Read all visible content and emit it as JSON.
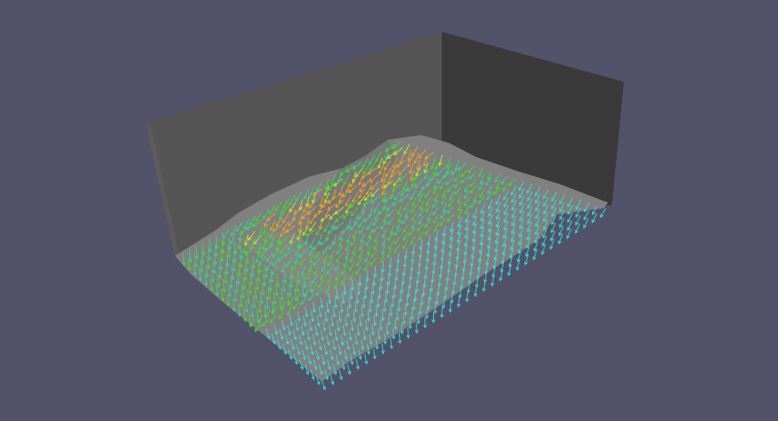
{
  "scene": {
    "background": "#52526b",
    "wall_back_left": "#555555",
    "wall_back_right": "#393939",
    "floor_edge": "#585858",
    "terrain_fill": "#808080",
    "terrain_shadow": "#6f6f6f",
    "glyph_colors": {
      "low": "#33e0d6",
      "mid_low": "#2fd88a",
      "mid": "#3be02a",
      "mid_high": "#b8f01e",
      "high": "#f0a020"
    }
  }
}
